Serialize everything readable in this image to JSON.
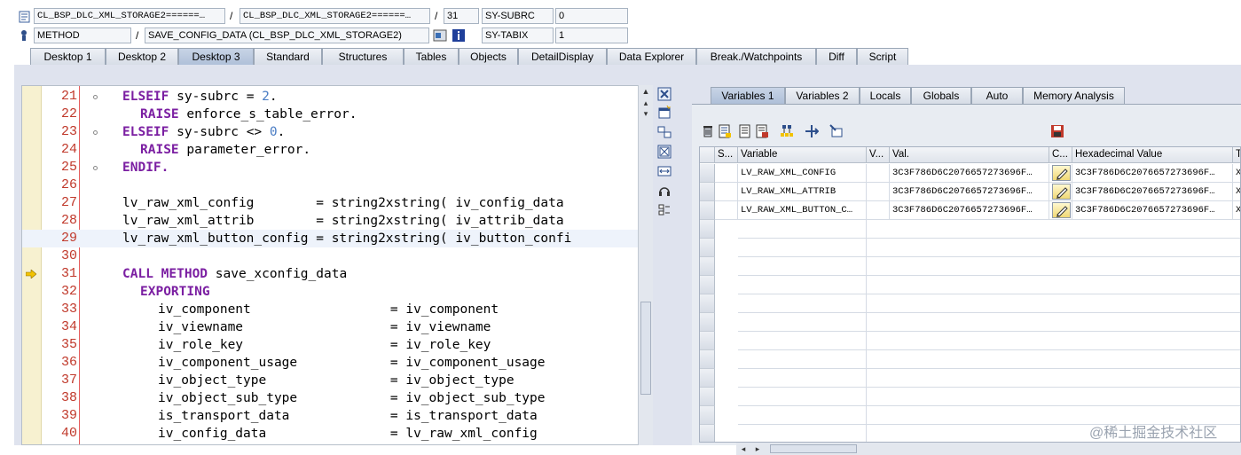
{
  "header": {
    "row1": {
      "program": "CL_BSP_DLC_XML_STORAGE2======…",
      "include": "CL_BSP_DLC_XML_STORAGE2======…",
      "line": "31",
      "var_name": "SY-SUBRC",
      "var_value": "0"
    },
    "row2": {
      "event_type": "METHOD",
      "event": "SAVE_CONFIG_DATA (CL_BSP_DLC_XML_STORAGE2)",
      "var_name": "SY-TABIX",
      "var_value": "1"
    },
    "slash": "/"
  },
  "tabs": [
    "Desktop 1",
    "Desktop 2",
    "Desktop 3",
    "Standard",
    "Structures",
    "Tables",
    "Objects",
    "DetailDisplay",
    "Data Explorer",
    "Break./Watchpoints",
    "Diff",
    "Script"
  ],
  "active_tab": "Desktop 3",
  "code_lines": [
    {
      "no": "21",
      "text": ""
    },
    {
      "no": "22",
      "text": ""
    },
    {
      "no": "23",
      "text": ""
    },
    {
      "no": "24",
      "text": ""
    },
    {
      "no": "25",
      "text": ""
    },
    {
      "no": "26",
      "text": ""
    },
    {
      "no": "27",
      "text": ""
    },
    {
      "no": "28",
      "text": ""
    },
    {
      "no": "29",
      "text": ""
    },
    {
      "no": "30",
      "text": ""
    },
    {
      "no": "31",
      "text": ""
    },
    {
      "no": "32",
      "text": ""
    },
    {
      "no": "33",
      "text": ""
    },
    {
      "no": "34",
      "text": ""
    },
    {
      "no": "35",
      "text": ""
    },
    {
      "no": "36",
      "text": ""
    },
    {
      "no": "37",
      "text": ""
    },
    {
      "no": "38",
      "text": ""
    },
    {
      "no": "39",
      "text": ""
    },
    {
      "no": "40",
      "text": ""
    }
  ],
  "code": {
    "l21": {
      "kw": "ELSEIF",
      "rest": " sy-subrc ",
      "op": "=",
      "num": " 2",
      "tail": "."
    },
    "l22": {
      "kw": "RAISE",
      "rest": " enforce_s_table_error."
    },
    "l23": {
      "kw": "ELSEIF",
      "rest": " sy-subrc ",
      "op": "<>",
      "num": " 0",
      "tail": "."
    },
    "l24": {
      "kw": "RAISE",
      "rest": " parameter_error."
    },
    "l25": {
      "kw": "ENDIF."
    },
    "l27": "lv_raw_xml_config        = string2xstring( iv_config_data",
    "l28": "lv_raw_xml_attrib        = string2xstring( iv_attrib_data",
    "l29": "lv_raw_xml_button_config = string2xstring( iv_button_confi",
    "l31": {
      "kw1": "CALL",
      "kw2": "METHOD",
      "rest": " save_xconfig_data"
    },
    "l32": {
      "kw": "EXPORTING"
    },
    "l33": "iv_component                  = iv_component",
    "l34": "iv_viewname                   = iv_viewname",
    "l35": "iv_role_key                   = iv_role_key",
    "l36": "iv_component_usage            = iv_component_usage",
    "l37": "iv_object_type                = iv_object_type",
    "l38": "iv_object_sub_type            = iv_object_sub_type",
    "l39": "is_transport_data             = is_transport_data",
    "l40": "iv_config_data                = lv_raw_xml_config"
  },
  "var_tabs": [
    "Variables 1",
    "Variables 2",
    "Locals",
    "Globals",
    "Auto",
    "Memory Analysis"
  ],
  "active_var_tab": "Variables 1",
  "grid": {
    "headers": [
      "S...",
      "Variable",
      "V...",
      "Val.",
      "C...",
      "Hexadecimal Value",
      "T"
    ],
    "rows": [
      {
        "variable": "LV_RAW_XML_CONFIG",
        "val": "3C3F786D6C2076657273696F…",
        "hex": "3C3F786D6C2076657273696F…",
        "t": "X"
      },
      {
        "variable": "LV_RAW_XML_ATTRIB",
        "val": "3C3F786D6C2076657273696F…",
        "hex": "3C3F786D6C2076657273696F…",
        "t": "X"
      },
      {
        "variable": "LV_RAW_XML_BUTTON_C…",
        "val": "3C3F786D6C2076657273696F…",
        "hex": "3C3F786D6C2076657273696F…",
        "t": "X"
      }
    ]
  },
  "watermark": "@稀土掘金技术社区",
  "colors": {
    "keyword": "#7b1fa2",
    "line_number": "#c0392b",
    "number": "#4a7dc4",
    "panel_bg": "#dfe3ee"
  }
}
